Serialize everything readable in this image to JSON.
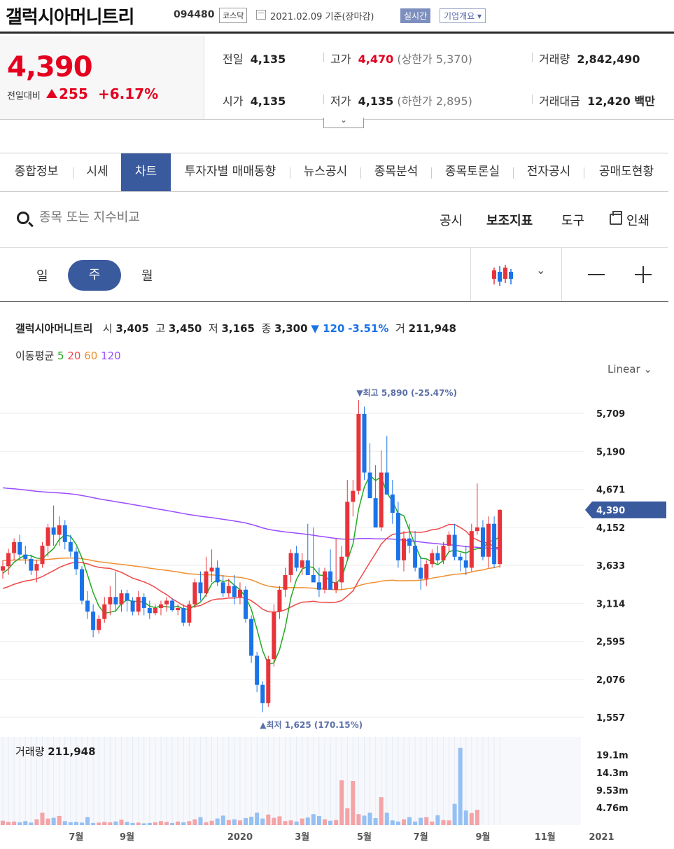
{
  "header": {
    "company_name": "갤럭시아머니트리",
    "code": "094480",
    "market_badge": "코스닥",
    "date_text": "2021.02.09  기준(장마감)",
    "realtime_badge": "실시간",
    "company_info_button": "기업개요 ▾"
  },
  "quote": {
    "price": "4,390",
    "change_label": "전일대비",
    "change_value": "255",
    "change_pct": "+6.17%",
    "prev_label": "전일",
    "prev_value": "4,135",
    "high_label": "고가",
    "high_value": "4,470",
    "upper_limit": "(상한가 5,370)",
    "volume_label": "거래량",
    "volume_value": "2,842,490",
    "open_label": "시가",
    "open_value": "4,135",
    "low_label": "저가",
    "low_value": "4,135",
    "lower_limit": "(하한가 2,895)",
    "amount_label": "거래대금",
    "amount_value": "12,420 백만",
    "expand_icon": "⌄"
  },
  "tabs": [
    "종합정보",
    "시세",
    "차트",
    "투자자별 매매동향",
    "뉴스공시",
    "종목분석",
    "종목토론실",
    "전자공시",
    "공매도현황"
  ],
  "toolbar": {
    "search_placeholder": "종목 또는 지수비교",
    "disclosure": "공시",
    "indicators": "보조지표",
    "tools": "도구",
    "print": "인쇄"
  },
  "periods": {
    "day": "일",
    "week": "주",
    "month": "월"
  },
  "ohlc_legend": {
    "name": "갤럭시아머니트리",
    "open_label": "시",
    "open": "3,405",
    "high_label": "고",
    "high": "3,450",
    "low_label": "저",
    "low": "3,165",
    "close_label": "종",
    "close": "3,300",
    "change": "▼ 120",
    "pct": "-3.51%",
    "vol_label": "거",
    "vol": "211,948"
  },
  "ma_legend": {
    "label": "이동평균",
    "ma5": "5",
    "ma20": "20",
    "ma60": "60",
    "ma120": "120"
  },
  "scale_mode": "Linear",
  "volume_legend": {
    "label": "거래량",
    "value": "211,948"
  },
  "colors": {
    "up": "#e8333a",
    "down": "#1a73e8",
    "ma5": "#22aa22",
    "ma20": "#f04848",
    "ma60": "#f09030",
    "ma120": "#9b4dff",
    "accent": "#3a5a9e"
  },
  "chart_data": {
    "type": "candlestick",
    "y_ticks": [
      "5,709",
      "5,190",
      "4,671",
      "4,152",
      "3,633",
      "3,114",
      "2,595",
      "2,076",
      "1,557"
    ],
    "y_tick_values": [
      5709,
      5190,
      4671,
      4152,
      3633,
      3114,
      2595,
      2076,
      1557
    ],
    "ylim": [
      1400,
      6000
    ],
    "x_ticks": [
      "7월",
      "9월",
      "2020",
      "3월",
      "5월",
      "7월",
      "9월",
      "11월",
      "2021"
    ],
    "x_tick_index": [
      13,
      22,
      42,
      53,
      64,
      74,
      85,
      96,
      106
    ],
    "max_annotation": "▼최고 5,890 (-25.47%)",
    "min_annotation": "▲최저 1,625 (170.15%)",
    "current_price_label": "4,390",
    "current_price": 4390,
    "volume_ticks": [
      "19.1m",
      "14.3m",
      "9.53m",
      "4.76m"
    ],
    "volume_tick_values": [
      19.1,
      14.3,
      9.53,
      4.76
    ],
    "volume_max": 24,
    "candles": [
      [
        3560,
        3700,
        3450,
        3620
      ],
      [
        3620,
        3860,
        3500,
        3800
      ],
      [
        3800,
        4000,
        3700,
        3950
      ],
      [
        3950,
        4050,
        3700,
        3780
      ],
      [
        3780,
        3900,
        3650,
        3720
      ],
      [
        3720,
        3780,
        3500,
        3560
      ],
      [
        3560,
        3700,
        3400,
        3650
      ],
      [
        3650,
        3950,
        3600,
        3900
      ],
      [
        3900,
        4200,
        3750,
        4150
      ],
      [
        4150,
        4450,
        3900,
        4050
      ],
      [
        4050,
        4300,
        3900,
        4180
      ],
      [
        4180,
        4250,
        3850,
        3950
      ],
      [
        3950,
        4050,
        3750,
        3820
      ],
      [
        3820,
        3880,
        3500,
        3580
      ],
      [
        3580,
        3620,
        3100,
        3150
      ],
      [
        3150,
        3280,
        2900,
        3000
      ],
      [
        3000,
        3100,
        2650,
        2750
      ],
      [
        2750,
        2950,
        2700,
        2900
      ],
      [
        2900,
        3200,
        2850,
        3100
      ],
      [
        3100,
        3350,
        2950,
        3200
      ],
      [
        3200,
        3550,
        3000,
        3100
      ],
      [
        3100,
        3300,
        3000,
        3250
      ],
      [
        3250,
        3300,
        3000,
        3150
      ],
      [
        3150,
        3200,
        2950,
        3000
      ],
      [
        3000,
        3280,
        2950,
        3200
      ],
      [
        3200,
        3250,
        2950,
        3050
      ],
      [
        3050,
        3150,
        2900,
        2980
      ],
      [
        2980,
        3100,
        2950,
        3050
      ],
      [
        3050,
        3150,
        2950,
        3100
      ],
      [
        3100,
        3200,
        3000,
        3150
      ],
      [
        3150,
        3180,
        3000,
        3020
      ],
      [
        3020,
        3100,
        2950,
        3050
      ],
      [
        3050,
        3100,
        2800,
        2850
      ],
      [
        2850,
        3150,
        2800,
        3100
      ],
      [
        3100,
        3450,
        3050,
        3400
      ],
      [
        3400,
        3550,
        3150,
        3250
      ],
      [
        3250,
        3750,
        3200,
        3550
      ],
      [
        3550,
        3850,
        3400,
        3600
      ],
      [
        3600,
        3700,
        3350,
        3400
      ],
      [
        3400,
        3500,
        3200,
        3250
      ],
      [
        3250,
        3450,
        3200,
        3350
      ],
      [
        3350,
        3500,
        3100,
        3200
      ],
      [
        3200,
        3400,
        3100,
        3300
      ],
      [
        3300,
        3350,
        2850,
        2900
      ],
      [
        2900,
        2950,
        2300,
        2400
      ],
      [
        2400,
        2450,
        1900,
        2000
      ],
      [
        2000,
        2050,
        1625,
        1750
      ],
      [
        1750,
        2400,
        1700,
        2350
      ],
      [
        2350,
        3100,
        2250,
        3000
      ],
      [
        3000,
        3350,
        2900,
        3300
      ],
      [
        3300,
        3600,
        3200,
        3500
      ],
      [
        3500,
        3850,
        3400,
        3800
      ],
      [
        3800,
        3900,
        3550,
        3600
      ],
      [
        3600,
        3800,
        3500,
        3700
      ],
      [
        3700,
        4200,
        3650,
        3500
      ],
      [
        3500,
        4150,
        3450,
        3400
      ],
      [
        3400,
        3600,
        3200,
        3300
      ],
      [
        3300,
        3600,
        3250,
        3550
      ],
      [
        3550,
        3850,
        3400,
        3300
      ],
      [
        3300,
        4000,
        3250,
        3400
      ],
      [
        3400,
        3900,
        3300,
        3750
      ],
      [
        3750,
        4800,
        3700,
        4500
      ],
      [
        4500,
        4800,
        4300,
        4650
      ],
      [
        4650,
        5890,
        4600,
        5700
      ],
      [
        5700,
        5800,
        4800,
        4900
      ],
      [
        4900,
        5300,
        4600,
        4550
      ],
      [
        4550,
        5000,
        4300,
        4150
      ],
      [
        4150,
        5200,
        4100,
        4900
      ],
      [
        4900,
        5400,
        4600,
        4600
      ],
      [
        4600,
        4800,
        4200,
        4350
      ],
      [
        4350,
        4500,
        3600,
        3700
      ],
      [
        3700,
        4100,
        3550,
        4000
      ],
      [
        4000,
        4200,
        3800,
        3900
      ],
      [
        3900,
        4100,
        3550,
        3600
      ],
      [
        3600,
        3750,
        3300,
        3450
      ],
      [
        3450,
        3700,
        3350,
        3650
      ],
      [
        3650,
        3850,
        3600,
        3800
      ],
      [
        3800,
        3900,
        3650,
        3700
      ],
      [
        3700,
        3950,
        3650,
        3900
      ],
      [
        3900,
        4100,
        3800,
        4050
      ],
      [
        4050,
        4200,
        3700,
        3750
      ],
      [
        3750,
        3800,
        3550,
        3700
      ],
      [
        3700,
        3900,
        3500,
        3600
      ],
      [
        3600,
        4200,
        3550,
        4100
      ],
      [
        4100,
        4750,
        4050,
        4150
      ],
      [
        4150,
        4250,
        3700,
        3750
      ],
      [
        3750,
        4300,
        3600,
        4200
      ],
      [
        4200,
        4300,
        3600,
        3650
      ],
      [
        3650,
        4400,
        3600,
        4390
      ]
    ],
    "volumes": [
      1.2,
      0.9,
      1.0,
      0.8,
      1.1,
      0.7,
      1.6,
      3.4,
      1.8,
      2.0,
      2.5,
      1.1,
      0.8,
      0.9,
      0.7,
      2.2,
      0.6,
      0.7,
      0.9,
      0.8,
      1.0,
      1.5,
      0.9,
      0.6,
      0.7,
      0.5,
      0.6,
      0.8,
      1.1,
      0.9,
      0.6,
      1.0,
      0.8,
      1.1,
      1.6,
      2.2,
      0.8,
      1.2,
      1.8,
      2.6,
      1.4,
      1.6,
      1.3,
      1.9,
      2.3,
      3.4,
      1.8,
      2.9,
      2.0,
      2.4,
      1.1,
      1.3,
      1.0,
      1.8,
      2.1,
      3.0,
      2.5,
      1.6,
      1.2,
      1.4,
      12.2,
      4.6,
      12.0,
      3.0,
      2.6,
      3.4,
      1.9,
      7.6,
      3.4,
      1.3,
      1.0,
      1.6,
      2.2,
      1.0,
      2.0,
      2.2,
      1.0,
      2.7,
      1.4,
      1.3,
      5.8,
      21.0,
      4.0,
      3.3,
      4.2
    ]
  }
}
